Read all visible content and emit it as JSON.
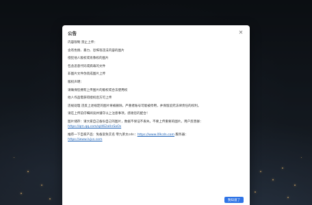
{
  "notice": {
    "title": "公告",
    "close_icon": "close-icon",
    "lines": [
      "内容限制 禁止上传：",
      "含有色情、暴力、恐怖等违法内容的图片",
      "侵犯他人版权或肖像权的图片",
      "包含恶意代码或病毒的文件",
      "非图片文件伪装成图片上传",
      "版权声明：",
      "请确保您拥有上传图片的版权或合法使用权",
      "他人作品需获得授权后方可上传",
      "违规处理 违反上述规定的图片将被删除，严重者账号可能被停用，并保留追究法律责任的权利。",
      "请在上传前仔细阅读并遵守以上注意事项，感谢您的配合！"
    ],
    "storage": {
      "text": "图片储存：请大家自己备份自己的图片，数据不保证不丢失。不要上传重要的图片。用户反馈群：",
      "link": "https://qm.qq.com/q/d62aHnSaOs"
    },
    "recommend": {
      "text1": "推荐一下自家产品：免备案免实名 零九莱太cdn：",
      "link1": "https://www.09cdn.com",
      "text2": " 服务器：",
      "link2": "https://www.lvjvs.com"
    },
    "ok_label": "我知道了"
  },
  "colors": {
    "accent": "#2f74e6",
    "link": "#1a5fb4"
  }
}
